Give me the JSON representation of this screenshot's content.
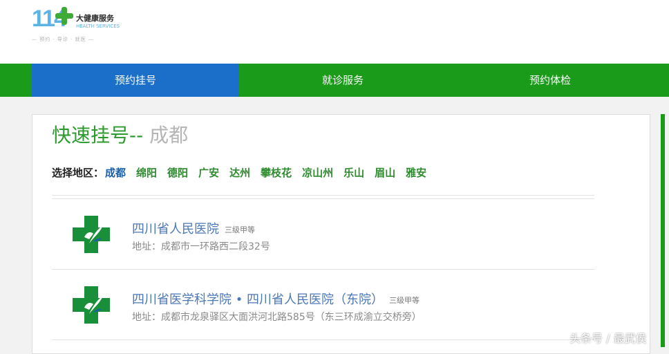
{
  "header": {
    "logo": {
      "number": "114",
      "name_cn": "大健康服务",
      "name_en": "HEALTH SERVICES",
      "tagline": "— 预约 · 导诊 · 就医 —"
    }
  },
  "nav": {
    "items": [
      {
        "label": "预约挂号",
        "active": true
      },
      {
        "label": "就诊服务",
        "active": false
      },
      {
        "label": "预约体检",
        "active": false
      }
    ]
  },
  "main": {
    "title": "快速挂号--",
    "current_city": "成都",
    "region_label": "选择地区：",
    "regions": [
      "成都",
      "绵阳",
      "德阳",
      "广安",
      "达州",
      "攀枝花",
      "凉山州",
      "乐山",
      "眉山",
      "雅安"
    ],
    "hospitals": [
      {
        "name": "四川省人民医院",
        "level": "三级甲等",
        "address": "地址：成都市一环路西二段32号"
      },
      {
        "name": "四川省医学科学院 • 四川省人民医院（东院）",
        "level": "三级甲等",
        "address": "地址：成都市龙泉驿区大面洪河北路585号（东三环成渝立交桥旁）"
      }
    ]
  },
  "watermark": "头条号 / 最武侯",
  "colors": {
    "nav_green": "#1a9b1a",
    "nav_active_blue": "#1b6fc8",
    "title_green": "#2e9a2e",
    "link_blue": "#4a78b8"
  }
}
